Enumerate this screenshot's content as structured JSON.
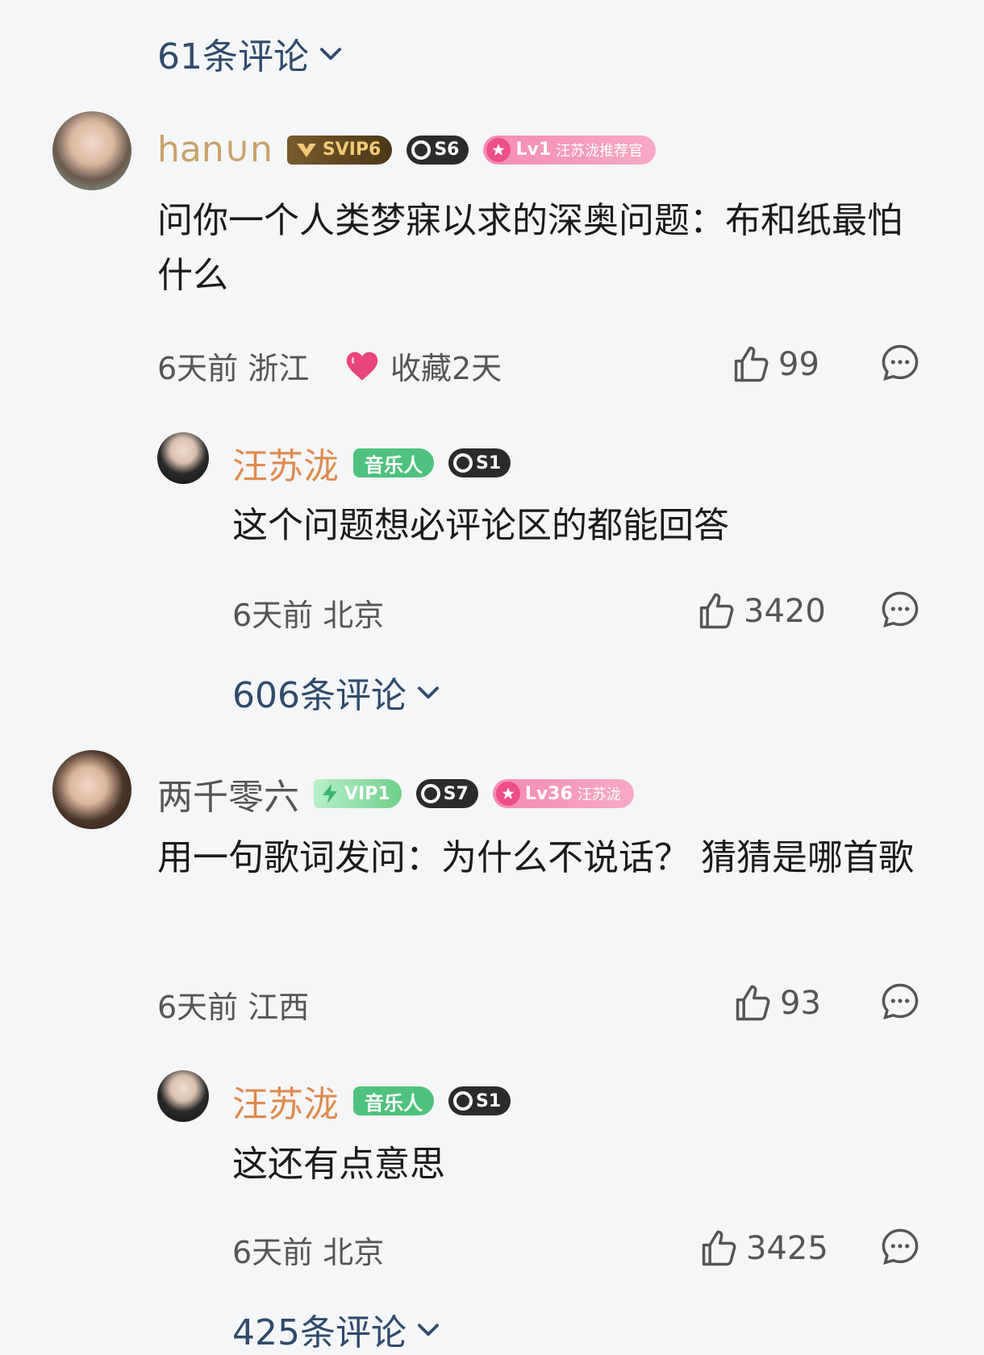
{
  "top_more": {
    "label": "61条评论"
  },
  "comments": [
    {
      "username": "han∪n",
      "badges": {
        "svip": "SVIP6",
        "level_s": "S6",
        "lv": "Lv1",
        "lv_sub": "汪苏泷推荐官"
      },
      "text": "问你一个人类梦寐以求的深奥问题：布和纸最怕什么",
      "time_location": "6天前 浙江",
      "favorite": "收藏2天",
      "likes": "99",
      "reply": {
        "username": "汪苏泷",
        "badges": {
          "music": "音乐人",
          "level_s": "S1"
        },
        "text": "这个问题想必评论区的都能回答",
        "time_location": "6天前 北京",
        "likes": "3420",
        "more": "606条评论"
      }
    },
    {
      "username": "两千零六",
      "badges": {
        "vip": "VIP1",
        "level_s": "S7",
        "lv": "Lv36",
        "lv_sub": "汪苏泷"
      },
      "text": "用一句歌词发问：为什么不说话？ 猜猜是哪首歌",
      "time_location": "6天前 江西",
      "likes": "93",
      "reply": {
        "username": "汪苏泷",
        "badges": {
          "music": "音乐人",
          "level_s": "S1"
        },
        "text": "这还有点意思",
        "time_location": "6天前 北京",
        "likes": "3425",
        "more": "425条评论"
      }
    }
  ],
  "colors": {
    "background": "#f5f6f7",
    "link": "#2f4a6b",
    "artist_name": "#e0894f",
    "gold_name": "#c9a26a",
    "meta_text": "#555555"
  },
  "icons": [
    "chevron-down-icon",
    "thumbs-up-icon",
    "comment-bubble-icon",
    "heart-icon",
    "star-icon",
    "lightning-icon",
    "vip-crown-icon"
  ]
}
